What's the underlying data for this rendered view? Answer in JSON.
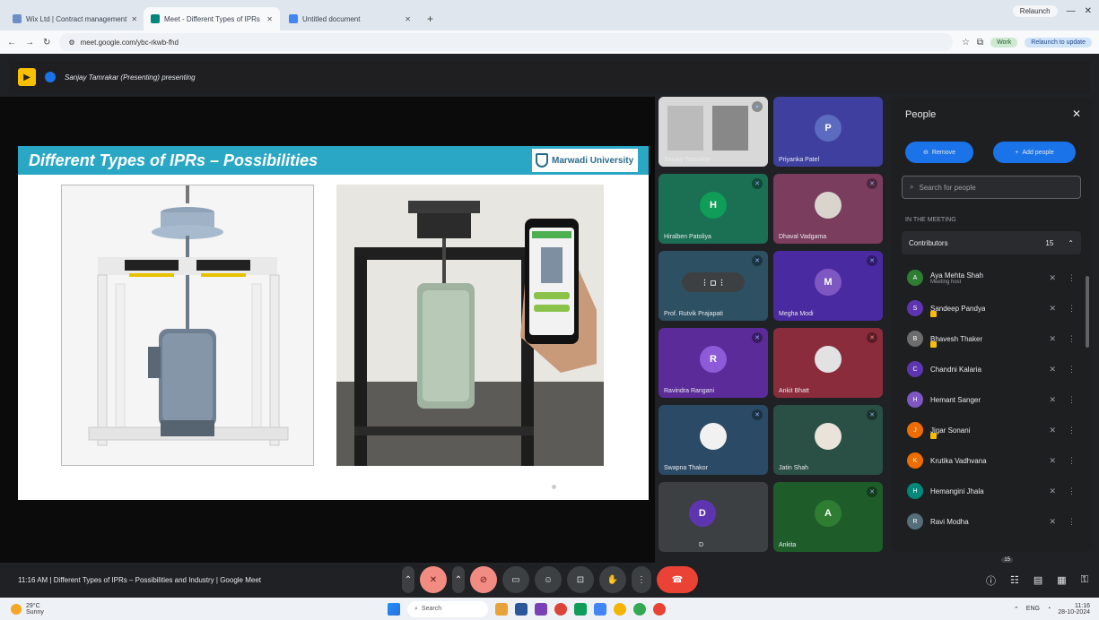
{
  "browser": {
    "tabs": [
      {
        "label": "Wix Ltd | Contract management",
        "active": false
      },
      {
        "label": "Meet - Different Types of IPRs",
        "active": true
      },
      {
        "label": "Untitled document",
        "active": false
      }
    ],
    "new_tab": "+",
    "window_controls": {
      "minimize": "—",
      "maximize": "□",
      "close": "✕",
      "profile_pill": "Relaunch"
    },
    "url": "meet.google.com/ybc-rkwb-fhd",
    "profile_label": "Work",
    "relaunch_label": "Relaunch to update"
  },
  "meet": {
    "presenting_text": "Sanjay Tamrakar (Presenting) presenting",
    "slide": {
      "title": "Different Types of IPRs – Possibilities",
      "logo_text": "Marwadi University"
    },
    "tiles": [
      {
        "name": "Sanjay Tamrakar",
        "initial": "",
        "color": "#5f6368"
      },
      {
        "name": "Priyanka Patel",
        "initial": "P",
        "color": "#3f3f9f"
      },
      {
        "name": "Hiralben Patoliya",
        "initial": "H",
        "color": "#1b6f53"
      },
      {
        "name": "Dhaval Vadgama",
        "initial": "",
        "color": "#7a3d5e"
      },
      {
        "name": "Prof. Rutvik Prajapati",
        "initial": "",
        "color": "#2d5163"
      },
      {
        "name": "Megha Modi",
        "initial": "M",
        "color": "#4a2aa1"
      },
      {
        "name": "Ravindra Rangani",
        "initial": "R",
        "color": "#5b2b9a"
      },
      {
        "name": "Ankit Bhatt",
        "initial": "",
        "color": "#8b2c3c"
      },
      {
        "name": "Swapna Thakor",
        "initial": "",
        "color": "#2b4a66"
      },
      {
        "name": "Jatin Shah",
        "initial": "",
        "color": "#2a4f44"
      },
      {
        "name": "D",
        "initial": "D",
        "color": "#3c4043"
      },
      {
        "name": "Ankita",
        "initial": "A",
        "color": "#1e5d2a"
      }
    ],
    "people_panel": {
      "title": "People",
      "add_people": "Add people",
      "remove": "Remove",
      "search_placeholder": "Search for people",
      "in_meeting_label": "IN THE MEETING",
      "section": "Contributors",
      "section_count": "15",
      "participants": [
        {
          "name": "Aya Mehta Shah",
          "sub": "Meeting host",
          "initial": "A",
          "color": "#2e7d32",
          "hand": false
        },
        {
          "name": "Sandeep Pandya",
          "sub": "",
          "initial": "S",
          "color": "#5e35b1",
          "hand": true
        },
        {
          "name": "Bhavesh Thaker",
          "sub": "",
          "initial": "B",
          "color": "#6d6d6d",
          "hand": true
        },
        {
          "name": "Chandni Kalaria",
          "sub": "",
          "initial": "C",
          "color": "#5e35b1",
          "hand": false
        },
        {
          "name": "Hemant Sanger",
          "sub": "",
          "initial": "H",
          "color": "#7e57c2",
          "hand": false
        },
        {
          "name": "Jigar Sonani",
          "sub": "",
          "initial": "J",
          "color": "#ef6c00",
          "hand": true
        },
        {
          "name": "Krutika Vadhvana",
          "sub": "",
          "initial": "K",
          "color": "#ef6c00",
          "hand": false
        },
        {
          "name": "Hemangini Jhala",
          "sub": "",
          "initial": "H",
          "color": "#00897b",
          "hand": false
        },
        {
          "name": "Ravi Modha",
          "sub": "",
          "initial": "R",
          "color": "#546e7a",
          "hand": false
        }
      ]
    },
    "bottom": {
      "time": "11:16 AM",
      "meeting_title": "Different Types of IPRs – Possibilities and Industry | Google Meet",
      "participants_badge": "15"
    }
  },
  "taskbar": {
    "weather_temp": "29°C",
    "weather_desc": "Sunny",
    "search_placeholder": "Search",
    "lang": "ENG",
    "time": "11:16",
    "date": "28-10-2024"
  }
}
